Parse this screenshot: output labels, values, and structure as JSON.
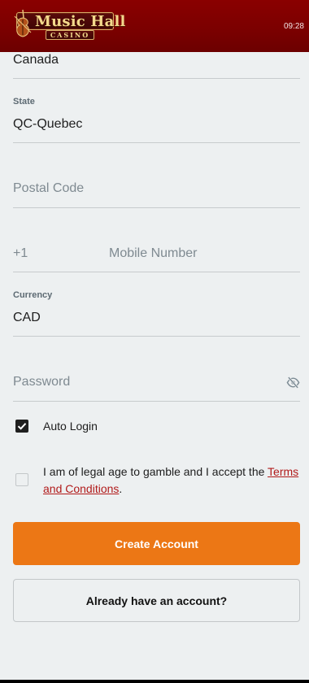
{
  "header": {
    "logo_text": "Music Hall",
    "logo_sub": "CASINO",
    "time": "09:28"
  },
  "form": {
    "country": {
      "value": "Canada"
    },
    "state": {
      "label": "State",
      "value": "QC-Quebec"
    },
    "postal_code": {
      "placeholder": "Postal Code"
    },
    "mobile": {
      "prefix": "+1",
      "placeholder": "Mobile Number"
    },
    "currency": {
      "label": "Currency",
      "value": "CAD"
    },
    "password": {
      "placeholder": "Password"
    },
    "auto_login": {
      "label": "Auto Login",
      "checked": true
    },
    "terms": {
      "text": "I am of legal age to gamble and I accept the ",
      "link_part1": "Terms",
      "link_part2": "and Conditions",
      "suffix": ".",
      "checked": false
    }
  },
  "buttons": {
    "create_account": "Create Account",
    "already_have_account": "Already have an account?"
  },
  "colors": {
    "header": "#7a0000",
    "primary": "#ec7715",
    "link": "#b11a1a",
    "background": "#edf0f1"
  }
}
